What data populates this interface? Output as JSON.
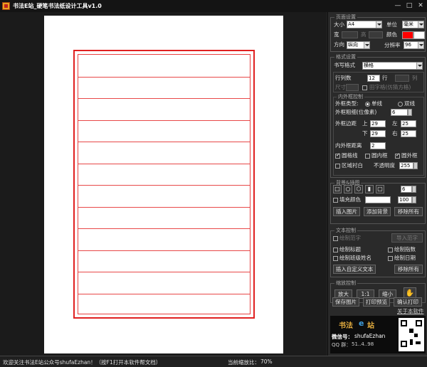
{
  "window": {
    "title": "书法E站_硬笔书法纸设计工具v1.0",
    "minimize": "—",
    "maximize": "□",
    "close": "✕"
  },
  "paper": {
    "rows": 12,
    "frame_color": "#e02020"
  },
  "page_settings": {
    "title": "页面设置",
    "size_label": "大小",
    "size_value": "A4",
    "unit_label": "单位",
    "unit_value": "毫米",
    "width_label": "宽",
    "height_label": "高",
    "color_label": "颜色",
    "color_value": "#ff0000",
    "orientation_label": "方向",
    "orientation_value": "纵向",
    "resolution_label": "分辨率",
    "resolution_value": "96"
  },
  "format_settings": {
    "title": "格式设置",
    "style_label": "书写格式",
    "style_value": "横格",
    "rows_label": "行列数",
    "rows_value": "12",
    "row_unit": "行",
    "col_unit": "列",
    "size_label": "尺寸",
    "rice_grid_label": "田字格(仿猜方格)"
  },
  "frame_settings": {
    "title": "内外框控制",
    "type_label": "外框类型:",
    "single_line": "单线",
    "double_line": "双线",
    "thickness_label": "外框粗细(位像素)",
    "thickness_value": "6",
    "margin_label": "外框边距",
    "top_label": "上",
    "top_value": "29",
    "left_label": "左",
    "left_value": "25",
    "bottom_label": "下",
    "bottom_value": "29",
    "right_label": "右",
    "right_value": "25",
    "inner_distance_label": "内外框距离",
    "inner_distance_value": "2",
    "round_grid": "圆格线",
    "round_inner": "圆内框",
    "round_outer": "圆外框",
    "area_white": "区域衬白",
    "opacity_label": "不透明度",
    "opacity_value": "255"
  },
  "background": {
    "title": "背景&插图",
    "count_value": "6",
    "fill_color_label": "填充颜色",
    "fill_opacity": "100",
    "insert_image": "插入图片",
    "add_background": "添加背景",
    "remove_all": "移除所有"
  },
  "text_control": {
    "title": "文本控制",
    "draw_sample": "绘制范字",
    "import_sample": "导入范字",
    "draw_title": "绘制标题",
    "draw_page_number": "绘制指数",
    "draw_class_name": "绘制班级姓名",
    "draw_date": "绘制日期",
    "insert_custom_text": "插入自定义文本",
    "remove_all": "移除所有"
  },
  "zoom_control": {
    "title": "缩放控制",
    "zoom_in": "放大",
    "actual": "1:1",
    "zoom_out": "缩小"
  },
  "actions": {
    "save_image": "保存图片",
    "print_preview": "打印预览",
    "confirm_print": "确认打印",
    "about": "关于本软件"
  },
  "ad": {
    "brand_1": "书法",
    "brand_2": "站",
    "brand_e": "e",
    "wechat_label": "微信号：",
    "wechat_value": "shufaEzhan",
    "qq_label": "QQ 群：",
    "qq_value": "51..4..98"
  },
  "status": {
    "welcome": "欢迎关注书法E站公众号shufaEzhan！（按F1打开本软件帮文档）",
    "zoom_label": "当前缩放比：",
    "zoom_value": "70%"
  }
}
